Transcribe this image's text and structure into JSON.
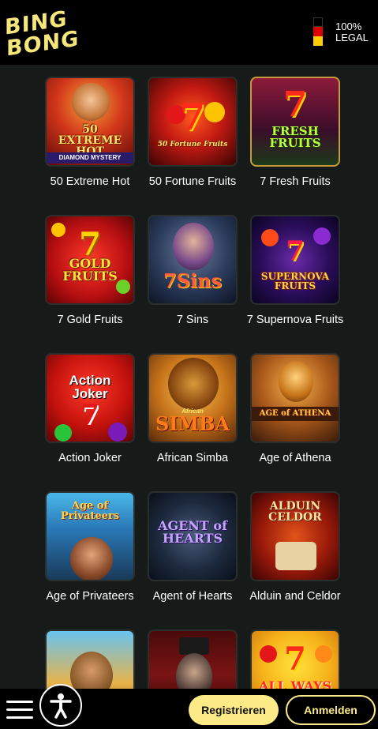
{
  "brand": {
    "line1": "BING",
    "line2": "BONG",
    "color": "#f6e77a"
  },
  "legal": {
    "line1": "100%",
    "line2": "LEGAL",
    "flag_colors": [
      "#000000",
      "#dd0000",
      "#ffce00"
    ]
  },
  "games": [
    {
      "label": "50 Extreme Hot",
      "art_title": "50 EXTREME HOT",
      "art_sub": "DIAMOND MYSTERY"
    },
    {
      "label": "50 Fortune Fruits",
      "art_title": "50 Fortune Fruits"
    },
    {
      "label": "7 Fresh Fruits",
      "art_title": "FRESH FRUITS",
      "art_seven": "7"
    },
    {
      "label": "7 Gold Fruits",
      "art_title": "GOLD FRUITS",
      "art_seven": "7"
    },
    {
      "label": "7 Sins",
      "art_title": "7Sins"
    },
    {
      "label": "7 Supernova Fruits",
      "art_title": "SUPERNOVA FRUITS",
      "art_seven": "7"
    },
    {
      "label": "Action Joker",
      "art_title": "Action Joker",
      "art_seven": "7"
    },
    {
      "label": "African Simba",
      "art_title": "SIMBA",
      "art_sub": "African"
    },
    {
      "label": "Age of Athena",
      "art_title": "AGE of ATHENA"
    },
    {
      "label": "Age of Privateers",
      "art_title": "Age of Privateers"
    },
    {
      "label": "Agent of Hearts",
      "art_title": "AGENT of HEARTS"
    },
    {
      "label": "Alduin and Celdor",
      "art_title": "ALDUIN CELDOR",
      "art_sub": "&"
    },
    {
      "label": "",
      "art_title": ""
    },
    {
      "label": "",
      "art_title": ""
    },
    {
      "label": "",
      "art_title": "ALL WAYS",
      "art_seven": "7"
    }
  ],
  "buttons": {
    "register": "Registrieren",
    "login": "Anmelden"
  },
  "icons": {
    "menu": "hamburger-menu-icon",
    "accessibility": "accessibility-icon"
  }
}
